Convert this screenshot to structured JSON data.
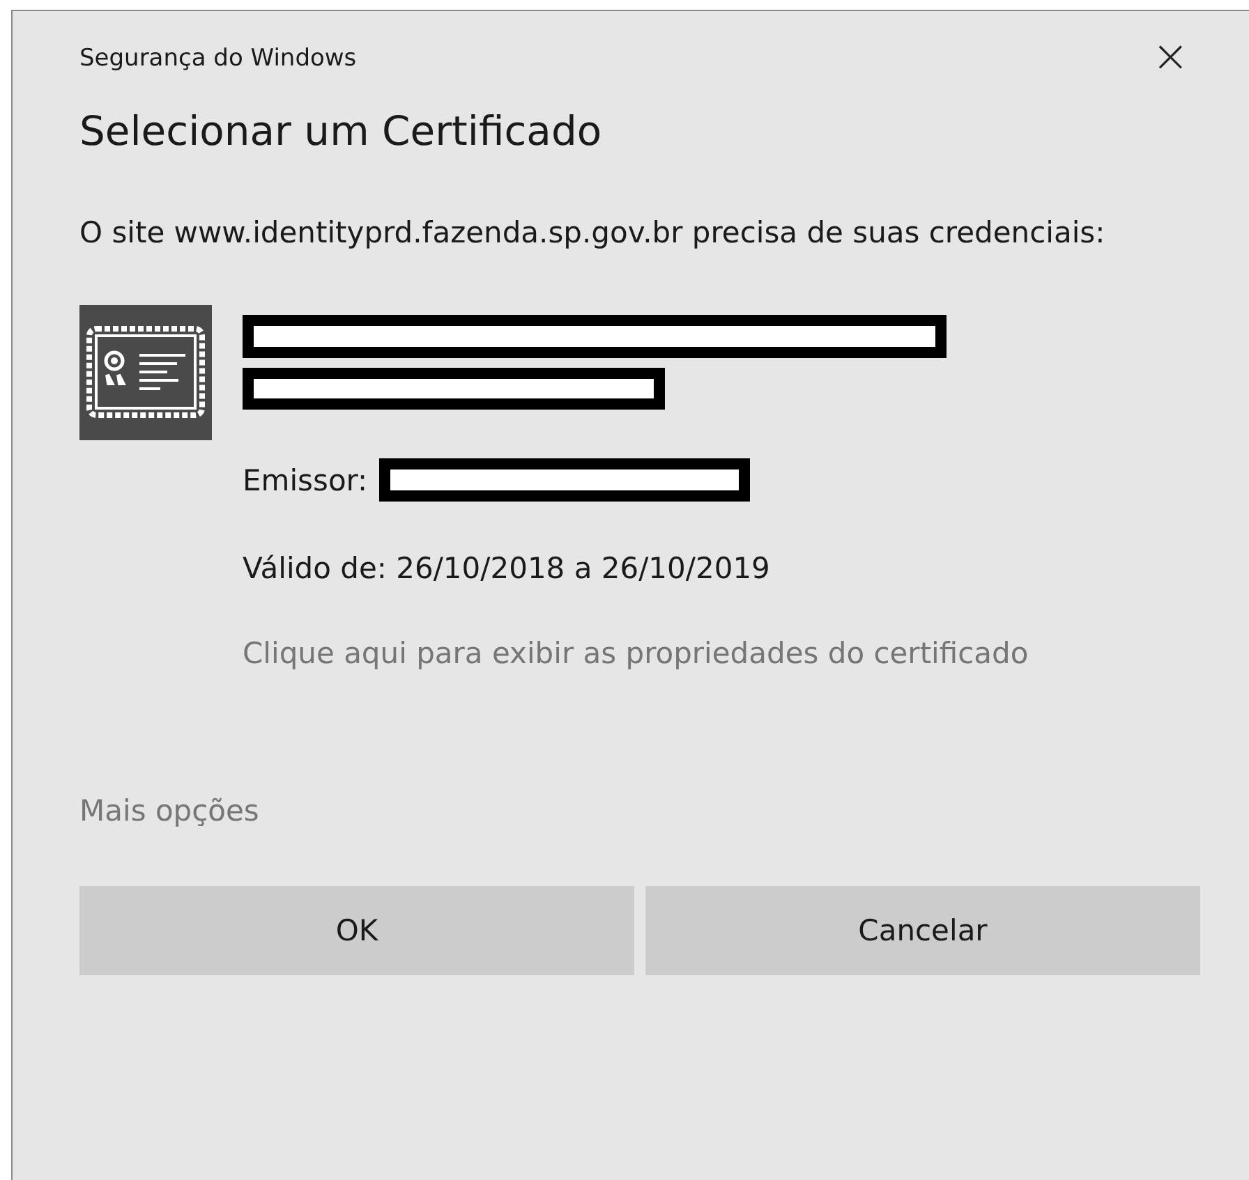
{
  "window": {
    "title": "Segurança do Windows",
    "close": "×"
  },
  "heading": "Selecionar um Certificado",
  "message": "O site www.identityprd.fazenda.sp.gov.br precisa de suas credenciais:",
  "certificate": {
    "issuer_label": "Emissor:",
    "validity": "Válido de: 26/10/2018 a 26/10/2019",
    "properties_link": "Clique aqui para exibir as propriedades do certificado"
  },
  "more_options": "Mais opções",
  "buttons": [
    {
      "label": "OK"
    },
    {
      "label": "Cancelar"
    }
  ]
}
